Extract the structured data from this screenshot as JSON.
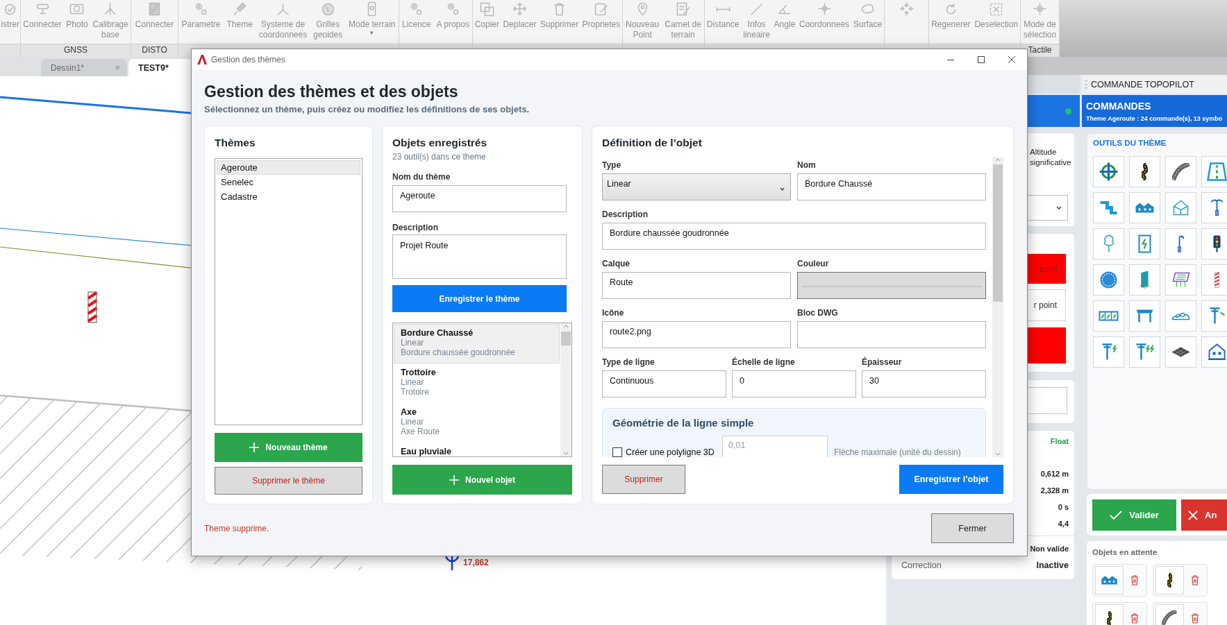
{
  "ribbon": {
    "groups": [
      {
        "buttons": [
          {
            "label": "istrer",
            "kind": "text"
          }
        ]
      },
      {
        "label": "GNSS",
        "buttons": [
          {
            "label": "Connecter",
            "kind": "text"
          },
          {
            "label": "Photo",
            "kind": "text"
          },
          {
            "label": "Calibrage\nbase",
            "kind": "text"
          }
        ]
      },
      {
        "label": "DISTO",
        "buttons": [
          {
            "label": "Connecter",
            "kind": "text"
          }
        ]
      },
      {
        "buttons": [
          {
            "label": "Parametre",
            "kind": "text"
          },
          {
            "label": "Theme",
            "kind": "text"
          },
          {
            "label": "Systeme de\ncoordonnees",
            "kind": "text"
          },
          {
            "label": "Grilles\ngeoides",
            "kind": "text"
          },
          {
            "label": "Mode terrain",
            "kind": "text",
            "caret": "▾"
          }
        ]
      },
      {
        "buttons": [
          {
            "label": "Licence",
            "kind": "text"
          },
          {
            "label": "A propos",
            "kind": "text"
          }
        ]
      },
      {
        "buttons": [
          {
            "label": "Copier",
            "kind": "text"
          },
          {
            "label": "Deplacer",
            "kind": "text"
          },
          {
            "label": "Supprimer",
            "kind": "text"
          },
          {
            "label": "Proprietes",
            "kind": "text"
          }
        ]
      },
      {
        "buttons": [
          {
            "label": "Nouveau\nPoint",
            "kind": "text"
          },
          {
            "label": "Carnet de\nterrain",
            "kind": "text"
          }
        ]
      },
      {
        "buttons": [
          {
            "label": "Distance",
            "kind": "text"
          },
          {
            "label": "Infos\nlineaire",
            "kind": "text"
          },
          {
            "label": "Angle",
            "kind": "text"
          },
          {
            "label": "Coordonnees",
            "kind": "text"
          },
          {
            "label": "Surface",
            "kind": "text"
          }
        ]
      },
      {
        "buttons": [
          {
            "kind": "icon"
          }
        ]
      },
      {
        "buttons": [
          {
            "label": "Regenerer",
            "kind": "text"
          },
          {
            "label": "Deselection",
            "kind": "text"
          }
        ]
      },
      {
        "label": "Tactile",
        "buttons": [
          {
            "label": "Mode de\nsélection",
            "kind": "text"
          }
        ]
      }
    ]
  },
  "tabs": [
    {
      "label": "Dessin1*",
      "close": "×",
      "selected": false
    },
    {
      "label": "TEST9*",
      "selected": true
    }
  ],
  "canvas": {
    "point_label": "17,862"
  },
  "survey_panel": {
    "altitude_label": "Altitude significative",
    "buttons": [
      {
        "label": "point",
        "kind": "danger"
      },
      {
        "label": "r point",
        "kind": "plain"
      },
      {
        "kind": "danger"
      }
    ],
    "fix_status": "Float",
    "readings": [
      "0,612 m",
      "2,328 m",
      "0 s",
      "4,4"
    ],
    "validity": "Non valide",
    "correction": {
      "label": "Correction",
      "value": "Inactive"
    }
  },
  "commands_panel": {
    "header": "COMMANDE TOPOPILOT",
    "title": "COMMANDES",
    "subtitle": "Theme Ageroute : 24 commande(s), 13 symbo",
    "tools_title": "OUTILS DU THÈME",
    "validate_button": "Valider",
    "cancel_button": "An",
    "pending_title": "Objets en attente"
  },
  "dialog": {
    "title": "Gestion des thèmes",
    "heading": "Gestion des thèmes et des objets",
    "subtitle": "Sélectionnez un thème, puis créez ou modifiez les définitions de ses objets.",
    "themes": {
      "title": "Thèmes",
      "items": [
        {
          "label": "Ageroute",
          "selected": true
        },
        {
          "label": "Senelec",
          "selected": false
        },
        {
          "label": "Cadastre",
          "selected": false
        }
      ],
      "add_button": "Nouveau thème",
      "delete_button": "Supprimer le thème"
    },
    "objects": {
      "title": "Objets enregistrés",
      "count": "23 outil(s) dans ce theme",
      "fields": [
        {
          "label": "Nom du thème",
          "value": "Ageroute",
          "kind": "text"
        },
        {
          "label": "Description",
          "value": "Projet Route",
          "kind": "textarea"
        }
      ],
      "save_button": "Enregistrer le thème",
      "items": [
        {
          "name": "Bordure Chaussé",
          "type": "Linear",
          "description": "Bordure chaussée goudronnée",
          "selected": true
        },
        {
          "name": "Trottoire",
          "type": "Linear",
          "description": "Trotoire",
          "selected": false
        },
        {
          "name": "Axe",
          "type": "Linear",
          "description": "Axe Route",
          "selected": false
        },
        {
          "name": "Eau pluviale",
          "selected": false
        }
      ],
      "add_button": "Nouvel objet"
    },
    "definition": {
      "title": "Définition de l’objet",
      "rows": [
        {
          "fields": [
            {
              "label": "Type",
              "value": "Linear",
              "kind": "select"
            },
            {
              "label": "Nom",
              "value": "Bordure Chaussé",
              "kind": "text"
            }
          ]
        },
        {
          "fields": [
            {
              "label": "Description",
              "value": "Bordure chaussée goudronnée",
              "kind": "text"
            }
          ]
        },
        {
          "fields": [
            {
              "label": "Calque",
              "value": "Route",
              "kind": "text"
            },
            {
              "label": "Couleur",
              "kind": "color"
            }
          ]
        },
        {
          "fields": [
            {
              "label": "Icône",
              "value": "route2.png",
              "kind": "text"
            },
            {
              "label": "Bloc DWG",
              "kind": "text"
            }
          ]
        },
        {
          "fields": [
            {
              "label": "Type de ligne",
              "value": "Continuous",
              "kind": "text"
            },
            {
              "label": "Échelle de ligne",
              "value": "0",
              "kind": "text"
            },
            {
              "label": "Épaisseur",
              "value": "30",
              "kind": "text"
            }
          ]
        }
      ],
      "geometry": {
        "title": "Géométrie de la ligne simple",
        "checkbox": {
          "label": "Créer une polyligne 3D",
          "checked": false
        },
        "input": {
          "placeholder": "0,01"
        },
        "hint": "Flèche maximale (unité du dessin)"
      },
      "delete_button": "Supprimer",
      "save_button": "Enregistrer l’objet"
    },
    "status": "Theme supprime.",
    "close_button": "Fermer"
  }
}
